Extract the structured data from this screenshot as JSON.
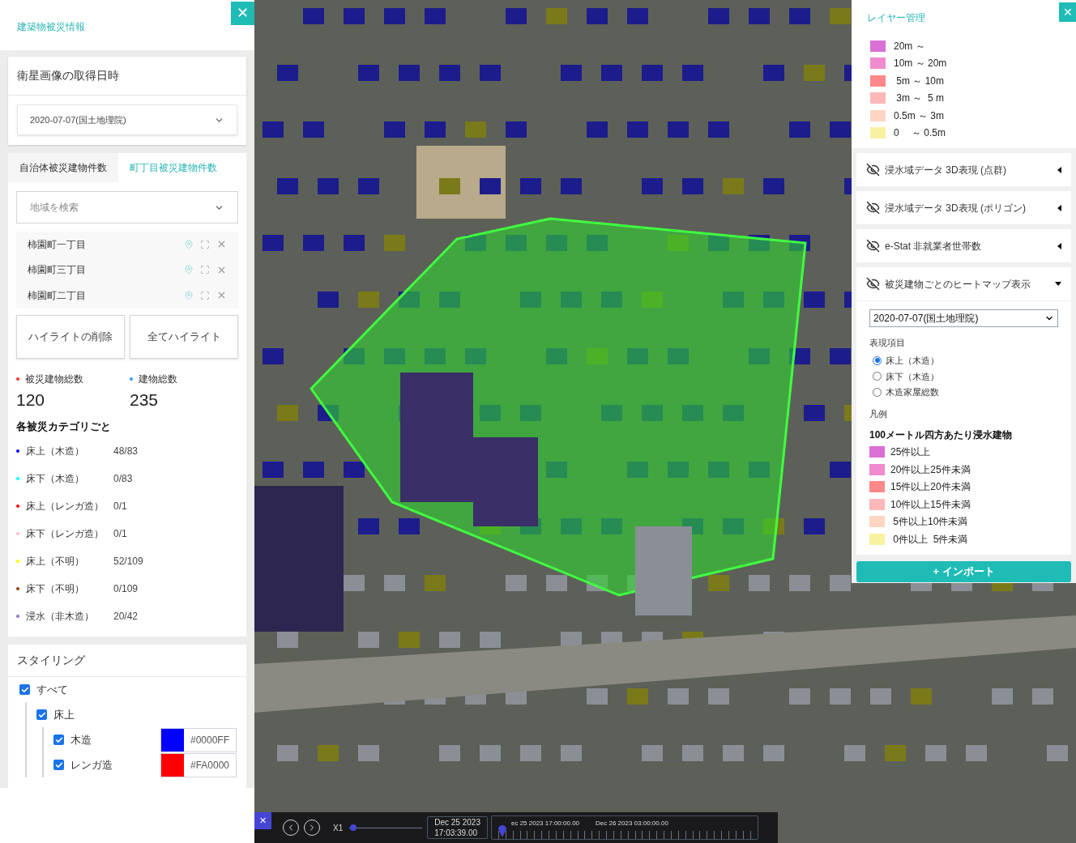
{
  "left_panel": {
    "title": "建築物被災情報",
    "close": "✕",
    "capture_date": {
      "heading": "衛星画像の取得日時",
      "value": "2020-07-07(国土地理院)"
    },
    "tabs": [
      {
        "label": "自治体被災建物件数",
        "selected": false
      },
      {
        "label": "町丁目被災建物件数",
        "selected": true
      }
    ],
    "search": {
      "placeholder": "地域を検索"
    },
    "areas": [
      {
        "name": "柿園町一丁目"
      },
      {
        "name": "柿園町三丁目"
      },
      {
        "name": "柿園町二丁目"
      }
    ],
    "buttons": [
      "ハイライトの削除",
      "全てハイライト"
    ],
    "totals": [
      {
        "label": "被災建物総数",
        "value": "120",
        "color": "#ff3030"
      },
      {
        "label": "建物総数",
        "value": "235",
        "color": "#3399ff"
      }
    ],
    "category_heading": "各被災カテゴリごと",
    "categories": [
      {
        "label": "床上（木造）",
        "value": "48/83",
        "color": "#0000ff"
      },
      {
        "label": "床下（木造）",
        "value": "0/83",
        "color": "#00ffff"
      },
      {
        "label": "床上（レンガ造）",
        "value": "0/1",
        "color": "#ff0000"
      },
      {
        "label": "床下（レンガ造）",
        "value": "0/1",
        "color": "#ffb6d9"
      },
      {
        "label": "床上（不明）",
        "value": "52/109",
        "color": "#ffff00"
      },
      {
        "label": "床下（不明）",
        "value": "0/109",
        "color": "#8b4513"
      },
      {
        "label": "浸水（非木造）",
        "value": "20/42",
        "color": "#9370db"
      }
    ],
    "styling": {
      "heading": "スタイリング",
      "tree": [
        {
          "label": "すべて",
          "checked": true,
          "children": [
            {
              "label": "床上",
              "checked": true,
              "children": [
                {
                  "label": "木造",
                  "checked": true,
                  "color": "#0000ff",
                  "hex": "#0000FF"
                },
                {
                  "label": "レンガ造",
                  "checked": true,
                  "color": "#ff0000",
                  "hex": "#FA0000"
                }
              ]
            }
          ]
        }
      ]
    }
  },
  "layer_panel": {
    "title": "レイヤー管理",
    "close": "✕",
    "depth_legend": [
      {
        "label": "20m ～",
        "color": "#da70d6"
      },
      {
        "label": "10m ～ 20m",
        "color": "#f08bcf"
      },
      {
        "label": " 5m ～ 10m",
        "color": "#ff8888"
      },
      {
        "label": " 3m ～  5 m",
        "color": "#ffb8b8"
      },
      {
        "label": "0.5m ～ 3m",
        "color": "#ffd5c3"
      },
      {
        "label": "0　 ～ 0.5m",
        "color": "#f8f1a0"
      }
    ],
    "layers": [
      {
        "label": "浸水域データ 3D表現 (点群)",
        "visible": false,
        "expanded": false
      },
      {
        "label": "浸水域データ 3D表現 (ポリゴン)",
        "visible": false,
        "expanded": false
      },
      {
        "label": "e-Stat 非就業者世帯数",
        "visible": false,
        "expanded": false
      },
      {
        "label": "被災建物ごとのヒートマップ表示",
        "visible": false,
        "expanded": true
      }
    ],
    "heatmap": {
      "date": "2020-07-07(国土地理院)",
      "items_heading": "表現項目",
      "options": [
        {
          "label": "床上（木造）",
          "selected": true
        },
        {
          "label": "床下（木造）",
          "selected": false
        },
        {
          "label": "木造家屋総数",
          "selected": false
        }
      ],
      "legend_heading": "凡例",
      "legend_title": "100メートル四方あたり浸水建物",
      "legend": [
        {
          "label": "25件以上",
          "color": "#da70d6"
        },
        {
          "label": "20件以上25件未満",
          "color": "#f08bcf"
        },
        {
          "label": "15件以上20件未満",
          "color": "#ff8888"
        },
        {
          "label": "10件以上15件未満",
          "color": "#ffb8b8"
        },
        {
          "label": " 5件以上10件未満",
          "color": "#ffd5c3"
        },
        {
          "label": " 0件以上  5件未満",
          "color": "#f8f1a0"
        }
      ]
    },
    "import_button": "+ インポート"
  },
  "timeline": {
    "close": "✕",
    "speed": "X1",
    "speed_slider": {
      "level": 0.05
    },
    "date": "Dec 25 2023",
    "time": "17:03:39.00",
    "ticks": [
      "ec 25 2023 17:00:00.00",
      "Dec 26 2023 03:00:00.00"
    ],
    "level": 0.02
  }
}
